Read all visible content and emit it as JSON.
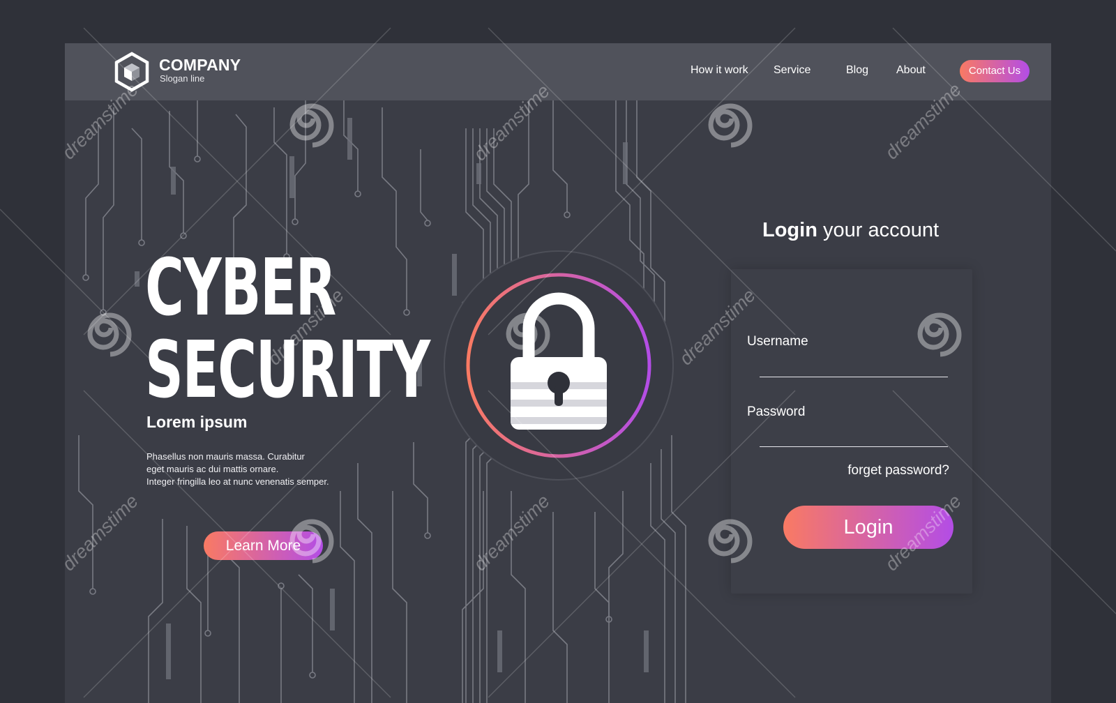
{
  "brand": {
    "name": "COMPANY",
    "slogan": "Slogan line"
  },
  "nav": {
    "links": [
      "How it work",
      "Service",
      "Blog",
      "About"
    ],
    "contact_label": "Contact Us"
  },
  "hero": {
    "title_line1": "CYBER",
    "title_line2": "SECURITY",
    "subtitle": "Lorem ipsum",
    "body_lines": [
      "Phasellus non mauris massa.  Curabitur",
      "eget mauris ac dui mattis ornare.",
      "Integer fringilla leo at nunc venenatis semper."
    ],
    "cta_label": "Learn More"
  },
  "login": {
    "title_bold": "Login",
    "title_rest": " your account",
    "username_label": "Username",
    "username_value": "",
    "password_label": "Password",
    "password_value": "",
    "forget_label": "forget password?",
    "submit_label": "Login"
  },
  "icons": {
    "logo": "hexagon-cube-logo-icon",
    "lock": "padlock-icon"
  },
  "watermark": {
    "text": "dreamstime"
  },
  "colors": {
    "page_background": "#2f3139",
    "panel_background": "#3b3d46",
    "navbar_background": "#50525b",
    "gradient_start": "#f97a63",
    "gradient_end": "#b34de6",
    "circuit_lines": "#8d8f98"
  }
}
